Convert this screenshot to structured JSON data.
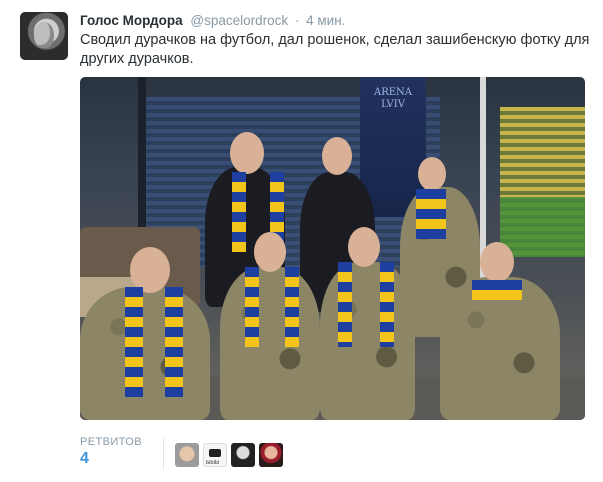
{
  "tweet": {
    "display_name": "Голос Мордора",
    "screen_name": "@spacelordrock",
    "separator": "·",
    "timestamp": "4 мин.",
    "text": "Сводил дурачков на футбол, дал рошенок, сделал зашибенскую фотку для других дурачков."
  },
  "photo": {
    "banner_text": "ARENA LVIV"
  },
  "stats": {
    "retweets_label": "РЕТВИТОВ",
    "retweets_count": "4"
  },
  "retweeters": [
    {
      "icon": "user-avatar-icon"
    },
    {
      "icon": "camera-avatar-icon",
      "caption": "ЫЫЫ"
    },
    {
      "icon": "user-avatar-icon"
    },
    {
      "icon": "user-avatar-icon"
    }
  ]
}
